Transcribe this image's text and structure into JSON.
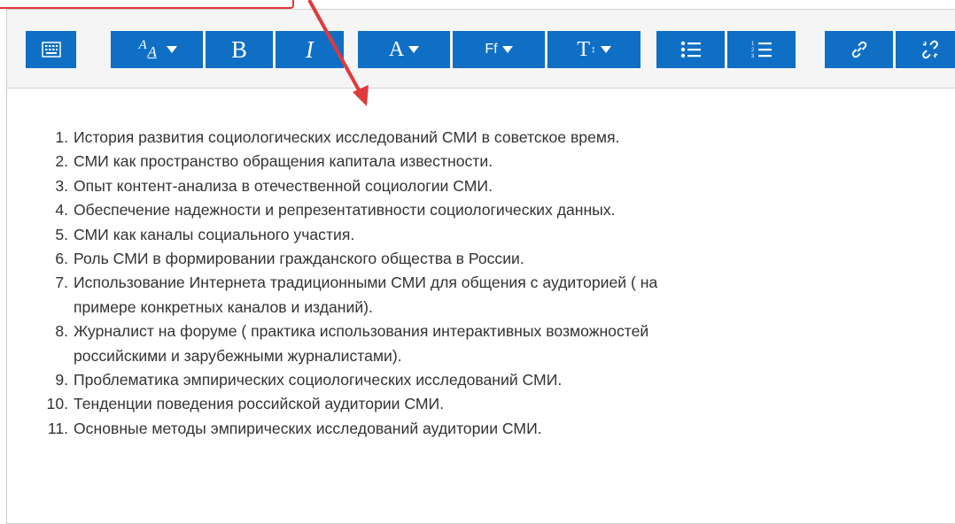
{
  "toolbar": {
    "buttons": [
      {
        "name": "toolbar-toggle-button",
        "icon": "toolbar-toggle-icon",
        "label": ""
      },
      {
        "name": "paragraph-style-button",
        "icon": "paragraph-style-icon",
        "label": "A",
        "sub": "A"
      },
      {
        "name": "bold-button",
        "icon": "bold-icon",
        "label": "B"
      },
      {
        "name": "italic-button",
        "icon": "italic-icon",
        "label": "I"
      },
      {
        "name": "font-color-button",
        "icon": "font-color-icon",
        "label": "A"
      },
      {
        "name": "font-family-button",
        "icon": "font-family-icon",
        "label": "Ff"
      },
      {
        "name": "font-size-button",
        "icon": "font-size-icon",
        "label": "T"
      },
      {
        "name": "bullet-list-button",
        "icon": "bullet-list-icon",
        "label": ""
      },
      {
        "name": "numbered-list-button",
        "icon": "numbered-list-icon",
        "label": ""
      },
      {
        "name": "link-button",
        "icon": "link-icon",
        "label": ""
      },
      {
        "name": "unlink-button",
        "icon": "unlink-icon",
        "label": ""
      }
    ]
  },
  "colors": {
    "button_bg": "#0f6fc5",
    "annotation": "#e0393b",
    "text": "#333333"
  },
  "content": {
    "items": [
      {
        "num": "1.",
        "text": "История развития социологических исследований СМИ в советское время."
      },
      {
        "num": "2.",
        "text": "СМИ как пространство обращения капитала известности."
      },
      {
        "num": "3.",
        "text": "Опыт контент-анализа в отечественной социологии СМИ."
      },
      {
        "num": "4.",
        "text": "Обеспечение надежности и репрезентативности социологических данных."
      },
      {
        "num": "5.",
        "text": "СМИ как каналы социального участия."
      },
      {
        "num": "6.",
        "text": "Роль СМИ в формировании гражданского общества в России."
      },
      {
        "num": "7.",
        "text": "Использование Интернета традиционными СМИ для общения с аудиторией ( на\nпримере конкретных каналов и изданий)."
      },
      {
        "num": "8.",
        "text": "Журналист на форуме ( практика использования интерактивных возможностей\nроссийскими и зарубежными журналистами)."
      },
      {
        "num": "9.",
        "text": "Проблематика эмпирических социологических исследований СМИ."
      },
      {
        "num": "10.",
        "text": "Тенденции поведения российской аудитории СМИ."
      },
      {
        "num": "11.",
        "text": "Основные методы эмпирических исследований аудитории СМИ."
      }
    ]
  }
}
